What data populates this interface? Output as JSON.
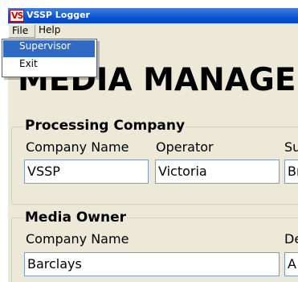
{
  "window": {
    "title": "VSSP Logger",
    "icon_text": "VS"
  },
  "menubar": {
    "file": "File",
    "help": "Help"
  },
  "file_menu": {
    "items": [
      "Supervisor",
      "Exit"
    ],
    "highlighted": "Supervisor"
  },
  "page": {
    "heading": "MEDIA MANAGE"
  },
  "processing_company": {
    "group_label": "Processing Company",
    "company_name_label": "Company Name",
    "operator_label": "Operator",
    "third_label": "Su",
    "company_name_value": "VSSP",
    "operator_value": "Victoria",
    "third_value": "Br"
  },
  "media_owner": {
    "group_label": "Media Owner",
    "company_name_label": "Company Name",
    "second_label": "De",
    "company_name_value": "Barclays",
    "second_value": "A"
  },
  "colors": {
    "titlebar": "#0a52d3",
    "menu_highlight": "#316ac5",
    "window_bg": "#ece9d8"
  }
}
